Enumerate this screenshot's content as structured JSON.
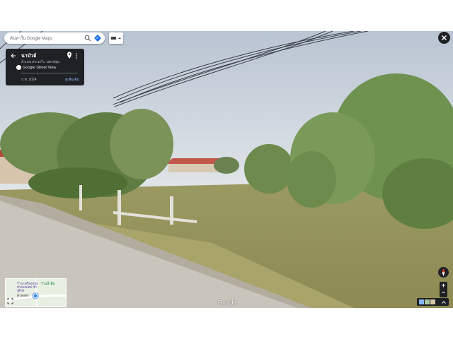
{
  "search": {
    "placeholder": "ค้นหาใน Google Maps"
  },
  "info_card": {
    "title": "นาบัวย์",
    "subtitle": "อำเภอ สระแก้ว, นครปฐม",
    "street_view_label": "Google Street View",
    "date": "ก.พ. 2024",
    "more_dates": "ดูเพิ่มเติม"
  },
  "minimap": {
    "label_1": "ร้าน เครื่องหนัง ทรงมณฑป ชำเสิร์ฟ",
    "label_2": "ร้านนํ้าดื่ม",
    "label_3": "ศาลหลัก"
  },
  "watermark": "Google",
  "controls": {
    "zoom_in": "+",
    "zoom_out": "−"
  },
  "colors": {
    "card_bg": "#202124",
    "accent_blue": "#1a73e8",
    "sky": "#c9d3df",
    "grass": "#a6a567"
  },
  "icons": [
    "menu-icon",
    "search-icon",
    "directions-icon",
    "layers-icon",
    "close-icon",
    "back-arrow-icon",
    "pin-icon",
    "kebab-icon",
    "street-view-logo-icon",
    "expand-icon",
    "compass-icon"
  ]
}
